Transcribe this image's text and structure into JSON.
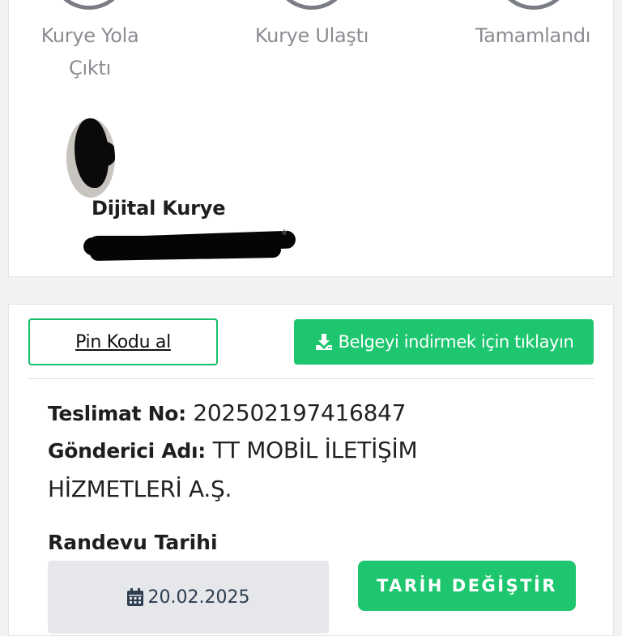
{
  "tracker": {
    "steps": [
      {
        "label_line1": "Kurye Yola",
        "label_line2": "Çıktı"
      },
      {
        "label_line1": "Kurye Ulaştı",
        "label_line2": ""
      },
      {
        "label_line1": "Tamamlandı",
        "label_line2": ""
      }
    ],
    "courier": {
      "name": "Dijital Kurye",
      "phone_suffix": "*"
    }
  },
  "actions": {
    "pin_button_label": "Pin Kodu al",
    "download_button_label": "Belgeyi indirmek için tıklayın",
    "download_icon": "download-icon"
  },
  "shipment": {
    "delivery_no_key": "Teslimat No:",
    "delivery_no_value": "202502197416847",
    "sender_key": "Gönderici Adı:",
    "sender_value_line1": "TT MOBİL İLETİŞİM",
    "sender_value_line2": "HİZMETLERİ A.Ş."
  },
  "appointment": {
    "title": "Randevu Tarihi",
    "date": "20.02.2025",
    "calendar_icon": "calendar-icon",
    "change_button_label": "TARİH DEĞİŞTİR"
  },
  "colors": {
    "accent": "#1dc66f",
    "step_ring": "#7a7d83",
    "muted_text": "#8a8d92"
  }
}
